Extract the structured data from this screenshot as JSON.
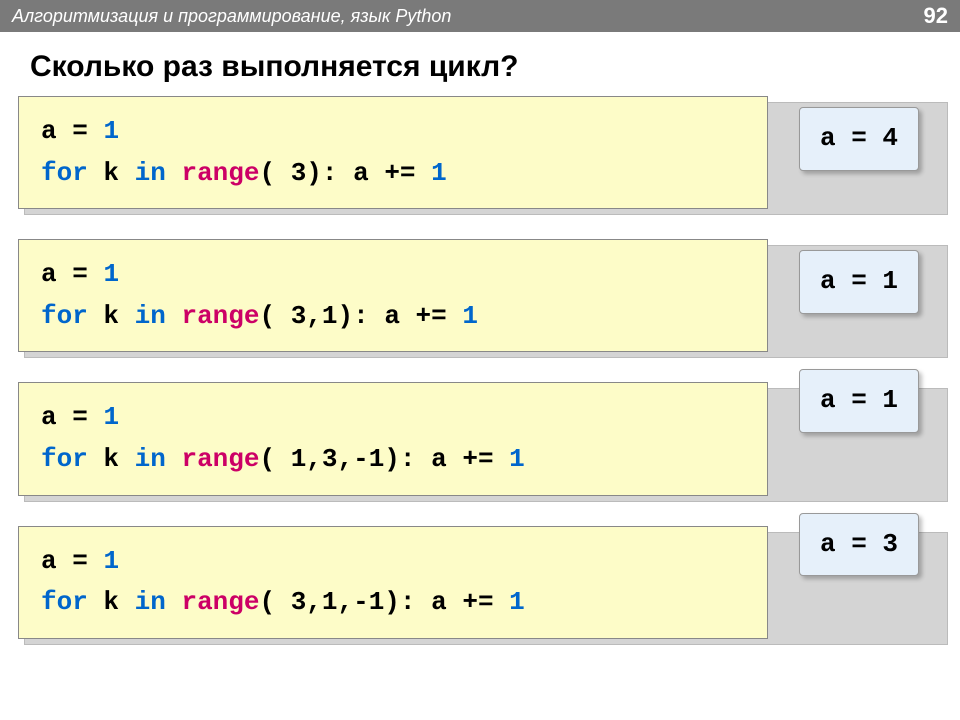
{
  "header": {
    "title": "Алгоритмизация и программирование, язык Python",
    "page": "92"
  },
  "main_title": "Сколько раз выполняется цикл?",
  "examples": [
    {
      "answer": "a = 4",
      "line1": {
        "var": "a",
        "op": "=",
        "num": "1"
      },
      "line2": {
        "kw1": "for",
        "var1": "k",
        "kw2": "in",
        "fn": "range",
        "args": "( 3):",
        "var2": "a",
        "op": "+=",
        "num": "1"
      }
    },
    {
      "answer": "a = 1",
      "line1": {
        "var": "a",
        "op": "=",
        "num": "1"
      },
      "line2": {
        "kw1": "for",
        "var1": "k",
        "kw2": "in",
        "fn": "range",
        "args": "( 3,1):",
        "var2": "a",
        "op": "+=",
        "num": "1"
      }
    },
    {
      "answer": "a = 1",
      "line1": {
        "var": "a",
        "op": "=",
        "num": "1"
      },
      "line2": {
        "kw1": "for",
        "var1": "k",
        "kw2": "in",
        "fn": "range",
        "args": "( 1,3,-1):",
        "var2": "a",
        "op": "+=",
        "num": "1"
      }
    },
    {
      "answer": "a = 3",
      "line1": {
        "var": "a",
        "op": "=",
        "num": "1"
      },
      "line2": {
        "kw1": "for",
        "var1": "k",
        "kw2": "in",
        "fn": "range",
        "args": "( 3,1,-1):",
        "var2": "a",
        "op": "+=",
        "num": "1"
      }
    }
  ]
}
